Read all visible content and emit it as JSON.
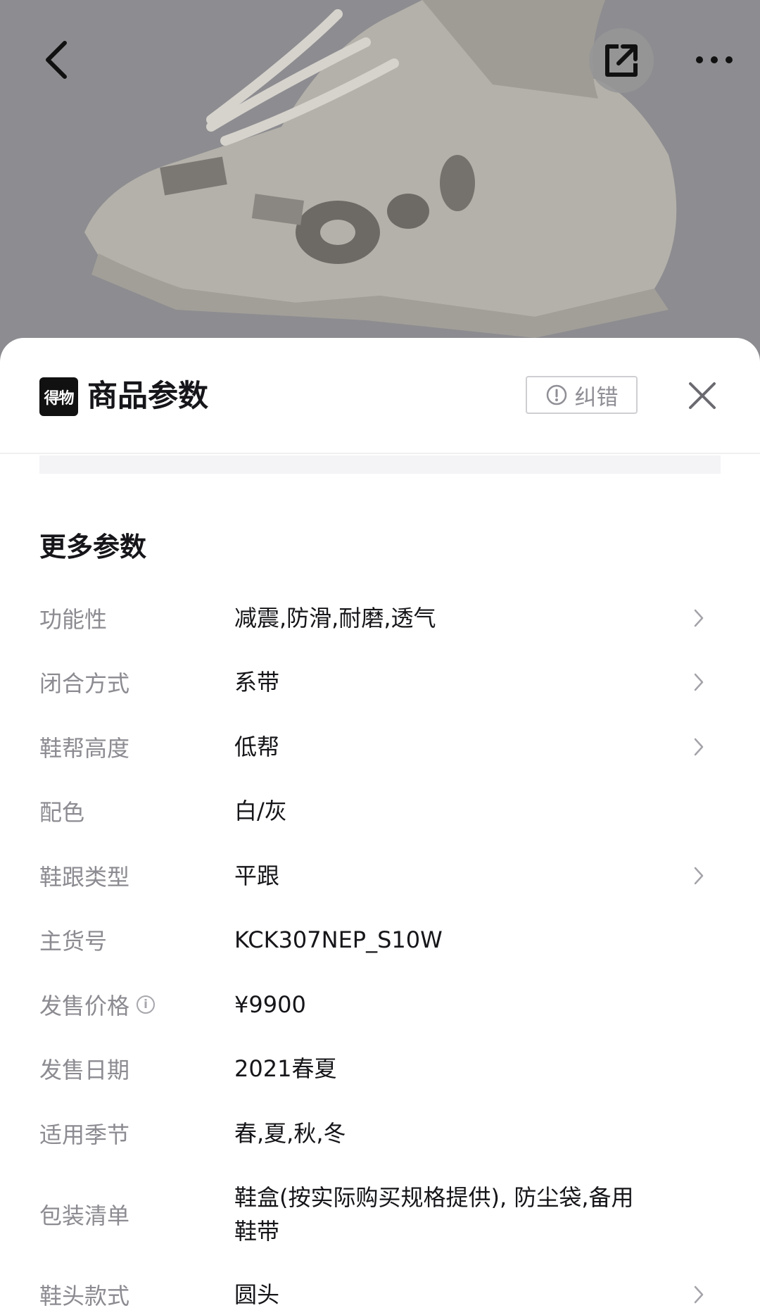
{
  "sheet": {
    "brand_logo_text": "得物",
    "title": "商品参数",
    "report_label": "纠错"
  },
  "section_title": "更多参数",
  "params": [
    {
      "label": "功能性",
      "value": "减震,防滑,耐磨,透气",
      "chevron": true
    },
    {
      "label": "闭合方式",
      "value": "系带",
      "chevron": true
    },
    {
      "label": "鞋帮高度",
      "value": "低帮",
      "chevron": true
    },
    {
      "label": "配色",
      "value": "白/灰",
      "chevron": false
    },
    {
      "label": "鞋跟类型",
      "value": "平跟",
      "chevron": true
    },
    {
      "label": "主货号",
      "value": "KCK307NEP_S10W",
      "chevron": false
    },
    {
      "label": "发售价格",
      "value": "¥9900",
      "chevron": false,
      "info_icon": true
    },
    {
      "label": "发售日期",
      "value": "2021春夏",
      "chevron": false
    },
    {
      "label": "适用季节",
      "value": "春,夏,秋,冬",
      "chevron": false
    },
    {
      "label": "包装清单",
      "value": "鞋盒(按实际购买规格提供), 防尘袋,备用鞋带",
      "chevron": false
    },
    {
      "label": "鞋头款式",
      "value": "圆头",
      "chevron": true
    }
  ],
  "icons": {
    "back": "chevron-left-icon",
    "share": "share-external-icon",
    "more": "more-dots-icon",
    "report": "alert-circle-icon",
    "close": "close-icon",
    "row": "chevron-right-icon",
    "info": "info-icon"
  }
}
